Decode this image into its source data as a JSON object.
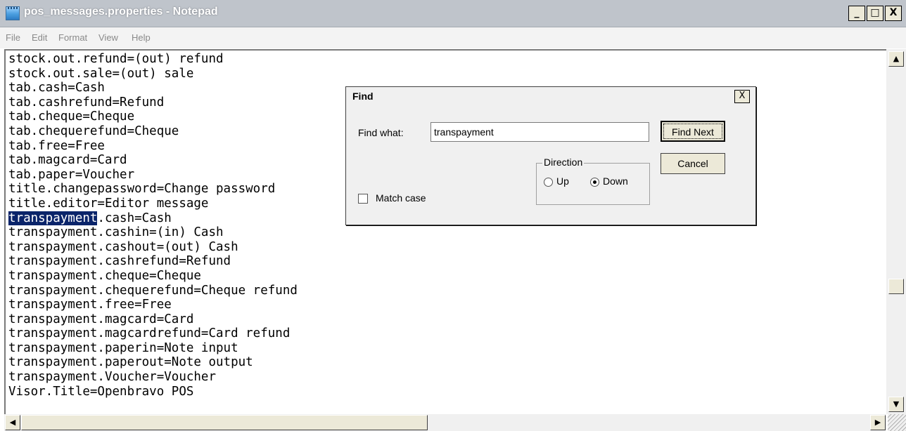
{
  "window": {
    "title": "pos_messages.properties - Notepad",
    "controls": {
      "minimize": "_",
      "maximize": "□",
      "close": "X"
    }
  },
  "menu": [
    "File",
    "Edit",
    "Format",
    "View",
    "Help"
  ],
  "editor": {
    "highlight": "transpayment",
    "lines": [
      "stock.out.refund=(out) refund",
      "stock.out.sale=(out) sale",
      "tab.cash=Cash",
      "tab.cashrefund=Refund",
      "tab.cheque=Cheque",
      "tab.chequerefund=Cheque",
      "tab.free=Free",
      "tab.magcard=Card",
      "tab.paper=Voucher",
      "title.changepassword=Change password",
      "title.editor=Editor message",
      "transpayment.cash=Cash",
      "transpayment.cashin=(in) Cash",
      "transpayment.cashout=(out) Cash",
      "transpayment.cashrefund=Refund",
      "transpayment.cheque=Cheque",
      "transpayment.chequerefund=Cheque refund",
      "transpayment.free=Free",
      "transpayment.magcard=Card",
      "transpayment.magcardrefund=Card refund",
      "transpayment.paperin=Note input",
      "transpayment.paperout=Note output",
      "transpayment.Voucher=Voucher",
      "Visor.Title=Openbravo POS"
    ]
  },
  "find_dialog": {
    "title": "Find",
    "close": "X",
    "find_what_label": "Find what:",
    "find_what_value": "transpayment",
    "find_next": "Find Next",
    "cancel": "Cancel",
    "direction_label": "Direction",
    "up_label": "Up",
    "down_label": "Down",
    "direction_selected": "Down",
    "match_case_label": "Match case",
    "match_case_checked": false
  },
  "scroll": {
    "up_arrow": "▲",
    "down_arrow": "▼",
    "left_arrow": "◀",
    "right_arrow": "▶"
  }
}
